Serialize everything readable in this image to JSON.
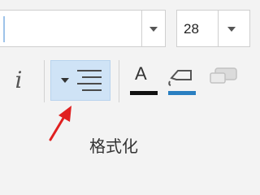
{
  "toolbar": {
    "font_name": {
      "value": "",
      "dropdown_icon": "chevron-down-icon"
    },
    "font_size": {
      "value": "28",
      "dropdown_icon": "chevron-down-icon"
    },
    "buttons": {
      "italic": {
        "label": "i",
        "icon": "italic-icon"
      },
      "align": {
        "icon": "align-dropdown-icon",
        "selected": true
      },
      "font_color": {
        "label": "A",
        "icon": "font-color-icon",
        "color": "#111111"
      },
      "fill_color": {
        "icon": "fill-color-icon",
        "color": "#2a7fc1"
      },
      "extra": {
        "icon": "shape-icon"
      }
    },
    "group_label": "格式化"
  },
  "annotation": {
    "icon": "red-arrow-icon",
    "color": "#e02020"
  }
}
